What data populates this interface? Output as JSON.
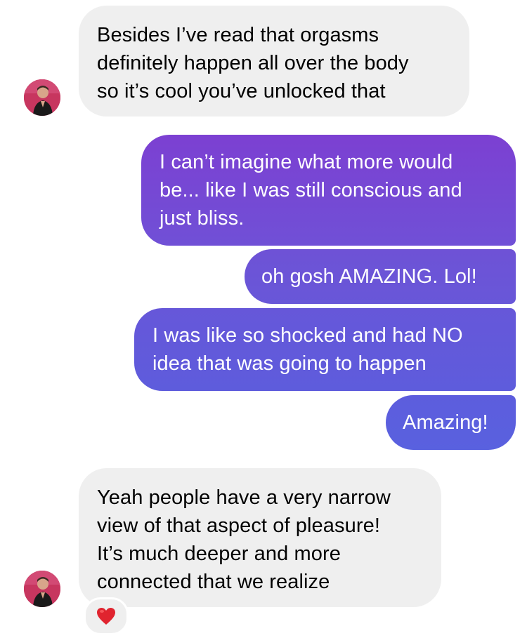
{
  "colors": {
    "incoming_bubble": "#efefef",
    "outgoing_gradient_top": "#7b3fd3",
    "outgoing_gradient_bottom": "#5a5fe0",
    "reaction_heart": "#e0242f"
  },
  "messages": [
    {
      "direction": "incoming",
      "text": "Besides I’ve read that orgasms\ndefinitely happen all over the body\nso it’s cool you’ve unlocked that",
      "avatar": "user-avatar-icon"
    },
    {
      "direction": "outgoing",
      "text": "I can’t imagine what more would\nbe... like I was still conscious and\njust bliss."
    },
    {
      "direction": "outgoing",
      "text": "oh gosh AMAZING. Lol!"
    },
    {
      "direction": "outgoing",
      "text": "I was like so shocked and had NO\nidea that was going to happen"
    },
    {
      "direction": "outgoing",
      "text": "Amazing!"
    },
    {
      "direction": "incoming",
      "text": "Yeah people have a very narrow\nview of that aspect of pleasure!\nIt’s much deeper and more\nconnected that we realize",
      "avatar": "user-avatar-icon",
      "reaction": "heart-icon"
    }
  ]
}
